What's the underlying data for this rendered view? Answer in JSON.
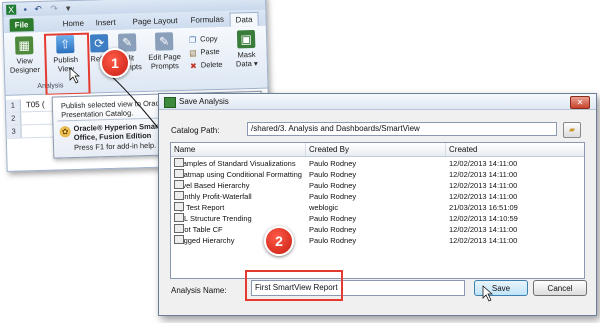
{
  "excel": {
    "tabs": [
      "File",
      "Home",
      "Insert",
      "Page Layout",
      "Formulas",
      "Data"
    ],
    "ribbon": {
      "view_designer": "View Designer",
      "publish_view": "Publish View",
      "refresh": "Refre",
      "edit_prompts": "Edit Prompts",
      "edit_page_prompts": "Edit Page Prompts",
      "copy": "Copy",
      "paste": "Paste",
      "delete": "Delete",
      "mask_data": "Mask Data ▾",
      "group_label": "Analysis"
    },
    "rows": [
      "1",
      "2",
      "3"
    ],
    "cell_a1": "T05 (",
    "tooltip": {
      "line1": "Publish selected view to Orac",
      "line2": "Presentation Catalog.",
      "addin1": "Oracle® Hyperion Smart V",
      "addin2": "Office, Fusion Edition",
      "addin3": "Press F1 for add-in help."
    }
  },
  "markers": {
    "step1": "1",
    "step2": "2"
  },
  "dialog": {
    "title": "Save Analysis",
    "catalog_path_label": "Catalog Path:",
    "catalog_path": "/shared/3. Analysis and Dashboards/SmartView",
    "columns": [
      "Name",
      "Created By",
      "Created"
    ],
    "rows": [
      {
        "name": "Examples of Standard Visualizations",
        "created_by": "Paulo Rodney",
        "created": "12/02/2013 14:11:00"
      },
      {
        "name": "Heatmap using Conditional Formatting",
        "created_by": "Paulo Rodney",
        "created": "12/02/2013 14:11:00"
      },
      {
        "name": "Level Based Hierarchy",
        "created_by": "Paulo Rodney",
        "created": "12/02/2013 14:11:00"
      },
      {
        "name": "Monthly Profit-Waterfall",
        "created_by": "Paulo Rodney",
        "created": "12/02/2013 14:11:00"
      },
      {
        "name": "My Test Report",
        "created_by": "weblogic",
        "created": "21/03/2013 16:51:09"
      },
      {
        "name": "P&L Structure Trending",
        "created_by": "Paulo Rodney",
        "created": "12/02/2013 14:10:59"
      },
      {
        "name": "Pivot Table CF",
        "created_by": "Paulo Rodney",
        "created": "12/02/2013 14:11:00"
      },
      {
        "name": "Ragged Hierarchy",
        "created_by": "Paulo Rodney",
        "created": "12/02/2013 14:11:00"
      }
    ],
    "analysis_name_label": "Analysis Name:",
    "analysis_name": "First SmartView Report",
    "save_label": "Save",
    "cancel_label": "Cancel",
    "close_glyph": "✕"
  },
  "colors": {
    "highlight": "#e53a2f",
    "marker": "#d9281a",
    "file_tab": "#2c7a2c"
  }
}
